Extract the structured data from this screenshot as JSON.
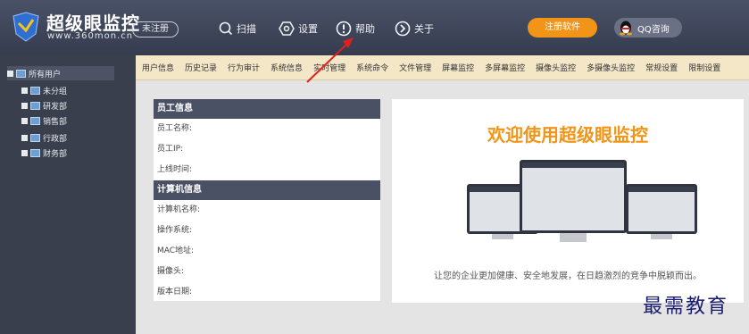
{
  "app": {
    "title": "超级眼监控",
    "url": "www.360mon.cn",
    "status_badge": "未注册"
  },
  "header": {
    "nav": [
      {
        "label": "扫描",
        "icon": "scan-icon"
      },
      {
        "label": "设置",
        "icon": "gear-icon"
      },
      {
        "label": "帮助",
        "icon": "help-icon"
      },
      {
        "label": "关于",
        "icon": "about-icon"
      }
    ],
    "register_label": "注册软件",
    "qq_label": "QQ咨询",
    "accent_color": "#f29418"
  },
  "sidebar": {
    "root": "所有用户",
    "groups": [
      "未分组",
      "研发部",
      "销售部",
      "行政部",
      "财务部"
    ]
  },
  "menu": {
    "items": [
      "用户信息",
      "历史记录",
      "行为审计",
      "系统信息",
      "实时管理",
      "系统命令",
      "文件管理",
      "屏幕监控",
      "多屏幕监控",
      "摄像头监控",
      "多摄像头监控",
      "常规设置",
      "限制设置"
    ]
  },
  "info": {
    "employee_header": "员工信息",
    "employee_fields": [
      "员工名称:",
      "员工IP:",
      "上线时间:"
    ],
    "computer_header": "计算机信息",
    "computer_fields": [
      "计算机名称:",
      "操作系统:",
      "MAC地址:",
      "摄像头:",
      "版本日期:"
    ]
  },
  "welcome": {
    "title": "欢迎使用超级眼监控",
    "subtitle": "让您的企业更加健康、安全地发展，在日趋激烈的竞争中脱颖而出。"
  },
  "watermark": "最需教育"
}
